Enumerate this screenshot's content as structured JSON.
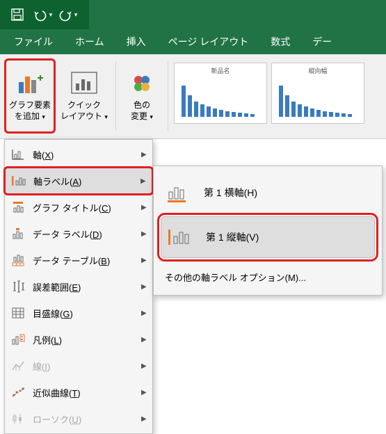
{
  "qat": {
    "save": "保存",
    "undo": "元に戻す",
    "redo": "やり直し"
  },
  "menubar": {
    "file": "ファイル",
    "home": "ホーム",
    "insert": "挿入",
    "pagelayout": "ページ レイアウト",
    "formulas": "数式",
    "data": "デー"
  },
  "ribbon": {
    "add_element_l1": "グラフ要素",
    "add_element_l2": "を追加",
    "quick_l1": "クイック",
    "quick_l2": "レイアウト",
    "color_l1": "色の",
    "color_l2": "変更",
    "thumb1_title": "新品名",
    "thumb2_title": "縦向幅"
  },
  "menu": {
    "items": [
      {
        "label_pre": "軸(",
        "ukey": "X",
        "label_post": ")",
        "icon": "axes-icon",
        "arrow": true,
        "disabled": false
      },
      {
        "label_pre": "軸ラベル(",
        "ukey": "A",
        "label_post": ")",
        "icon": "axis-label-icon",
        "arrow": true,
        "disabled": false,
        "hover": true,
        "highlighted": true
      },
      {
        "label_pre": "グラフ タイトル(",
        "ukey": "C",
        "label_post": ")",
        "icon": "chart-title-icon",
        "arrow": true,
        "disabled": false
      },
      {
        "label_pre": "データ ラベル(",
        "ukey": "D",
        "label_post": ")",
        "icon": "data-label-icon",
        "arrow": true,
        "disabled": false
      },
      {
        "label_pre": "データ テーブル(",
        "ukey": "B",
        "label_post": ")",
        "icon": "data-table-icon",
        "arrow": true,
        "disabled": false
      },
      {
        "label_pre": "誤差範囲(",
        "ukey": "E",
        "label_post": ")",
        "icon": "error-bars-icon",
        "arrow": true,
        "disabled": false
      },
      {
        "label_pre": "目盛線(",
        "ukey": "G",
        "label_post": ")",
        "icon": "gridlines-icon",
        "arrow": true,
        "disabled": false
      },
      {
        "label_pre": "凡例(",
        "ukey": "L",
        "label_post": ")",
        "icon": "legend-icon",
        "arrow": true,
        "disabled": false
      },
      {
        "label_pre": "線(",
        "ukey": "I",
        "label_post": ")",
        "icon": "lines-icon",
        "arrow": true,
        "disabled": true
      },
      {
        "label_pre": "近似曲線(",
        "ukey": "T",
        "label_post": ")",
        "icon": "trendline-icon",
        "arrow": true,
        "disabled": false
      },
      {
        "label_pre": "ローソク(",
        "ukey": "U",
        "label_post": ")",
        "icon": "updown-bars-icon",
        "arrow": true,
        "disabled": true
      }
    ]
  },
  "submenu": {
    "items": [
      {
        "label_pre": "第 1 横軸(",
        "ukey": "H",
        "label_post": ")"
      },
      {
        "label_pre": "第 1 縦軸(",
        "ukey": "V",
        "label_post": ")",
        "hover": true,
        "highlighted": true
      }
    ],
    "more_pre": "その他の軸ラベル オプション(",
    "more_ukey": "M",
    "more_post": ")..."
  },
  "colors": {
    "green_dark": "#0d6230",
    "green": "#217346",
    "highlight": "#e02020",
    "orange": "#e8792a",
    "blue": "#3a7bbf",
    "grey_icon": "#6b6b6b"
  }
}
